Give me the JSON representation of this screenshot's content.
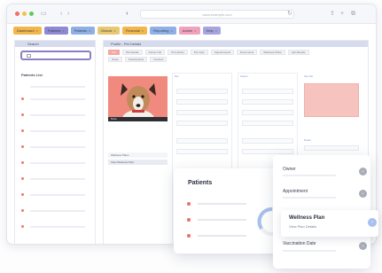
{
  "browser": {
    "url": "www.example.com"
  },
  "tabs": [
    {
      "label": "Dashboard",
      "color": "#f3b64a"
    },
    {
      "label": "Patients",
      "color": "#8f89d4"
    },
    {
      "label": "Patients",
      "color": "#8fb0e6"
    },
    {
      "label": "Clinical",
      "color": "#e9c870"
    },
    {
      "label": "Financial",
      "color": "#f3b64a"
    },
    {
      "label": "Reporting",
      "color": "#8fb0e6"
    },
    {
      "label": "Admin",
      "color": "#f0a2bd"
    },
    {
      "label": "Help",
      "color": "#a7a5e0"
    }
  ],
  "sidebar": {
    "header": "Search",
    "title": "Patients List"
  },
  "main": {
    "header": "Profile - Pet Details",
    "subtabs": [
      "Info",
      "Pet Details",
      "Owner Info",
      "Pet History",
      "Pet Care",
      "Appointments",
      "Documents",
      "Wellness Plans",
      "Lab Results",
      "Notes",
      "Prescriptions",
      "Invoices"
    ],
    "photo_caption": "Bella",
    "columns": [
      "Pet",
      "Owner",
      "Vet Info",
      "Notes"
    ],
    "list_rows": [
      "Wellness Plans",
      "View Wellness Plan"
    ]
  },
  "patients_card": {
    "title": "Patients"
  },
  "right_card": {
    "items": [
      "Owner",
      "Appointment",
      "Vaccination Date"
    ],
    "wellness_title": "Wellness Plan",
    "wellness_sub": "View Plan Details"
  }
}
